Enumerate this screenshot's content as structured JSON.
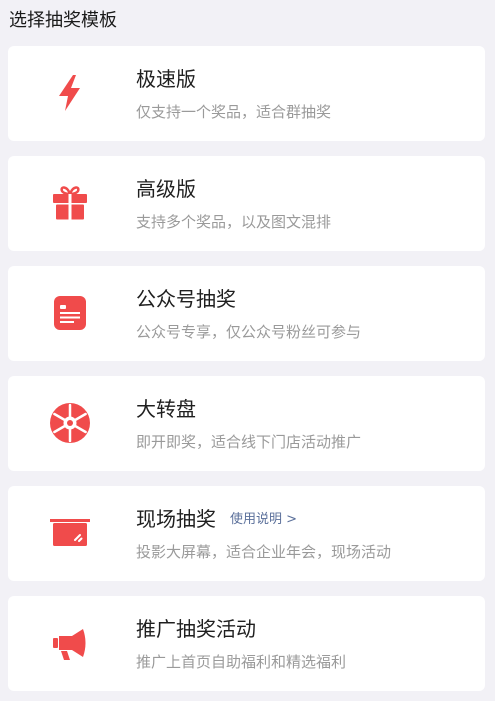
{
  "page": {
    "title": "选择抽奖模板"
  },
  "colors": {
    "accent": "#f04b4b",
    "background": "#f2f1f6",
    "card": "#ffffff",
    "title_text": "#1f1f1f",
    "desc_text": "#9a9a9a",
    "link_text": "#5a6f9a"
  },
  "templates": [
    {
      "icon": "lightning-icon",
      "title": "极速版",
      "desc": "仅支持一个奖品，适合群抽奖"
    },
    {
      "icon": "gift-icon",
      "title": "高级版",
      "desc": "支持多个奖品，以及图文混排"
    },
    {
      "icon": "document-icon",
      "title": "公众号抽奖",
      "desc": "公众号专享，仅公众号粉丝可参与"
    },
    {
      "icon": "wheel-icon",
      "title": "大转盘",
      "desc": "即开即奖，适合线下门店活动推广"
    },
    {
      "icon": "screen-icon",
      "title": "现场抽奖",
      "desc": "投影大屏幕，适合企业年会，现场活动",
      "link": "使用说明 >"
    },
    {
      "icon": "megaphone-icon",
      "title": "推广抽奖活动",
      "desc": "推广上首页自助福利和精选福利"
    }
  ]
}
